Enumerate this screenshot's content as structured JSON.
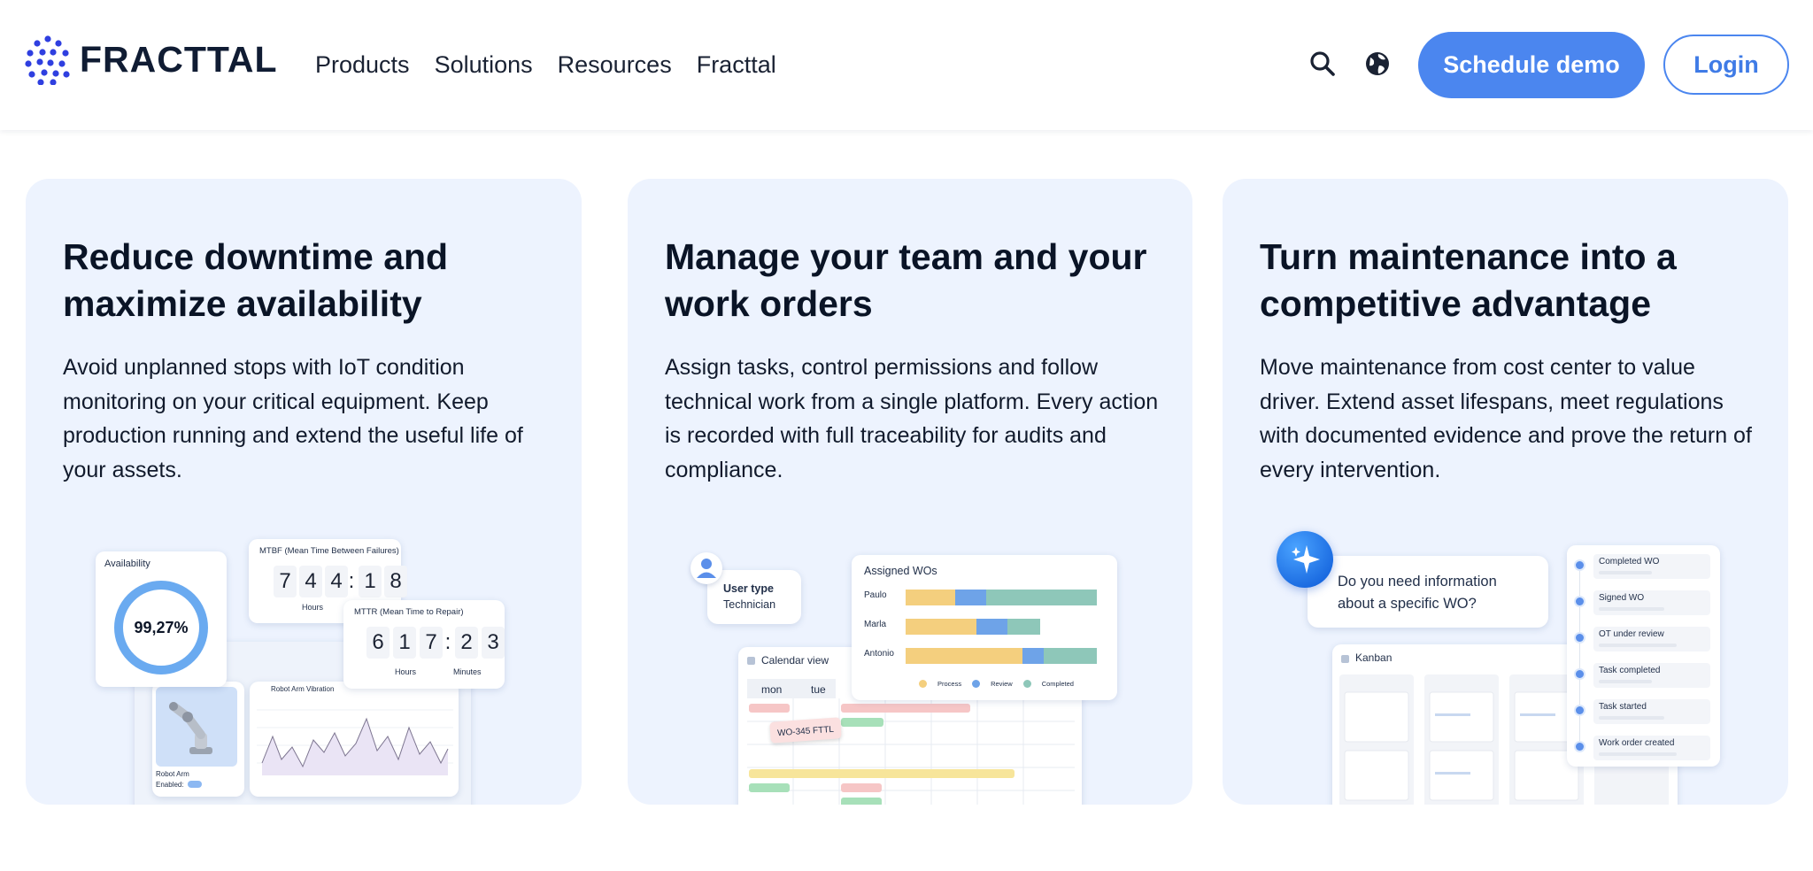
{
  "brand": {
    "name": "FRACTTAL",
    "accent": "#4b86ef",
    "logo_dot_color": "#2f3fe0"
  },
  "nav": {
    "items": [
      "Products",
      "Solutions",
      "Resources",
      "Fracttal"
    ]
  },
  "header": {
    "search_icon": "search-icon",
    "language_icon": "globe-icon",
    "demo_label": "Schedule demo",
    "login_label": "Login"
  },
  "cards": [
    {
      "title": "Reduce downtime and maximize availability",
      "body": "Avoid unplanned stops with IoT condition monitoring on your critical equipment. Keep production running and extend the useful life of your assets.",
      "widgets": {
        "availability_label": "Availability",
        "availability_value": "99,27%",
        "availability_fraction": 0.9927,
        "mtbf_label": "MTBF (Mean Time Between Failures)",
        "mtbf_digits": [
          "7",
          "4",
          "4",
          ":",
          "1",
          "8"
        ],
        "mtbf_unit": "Hours",
        "mttr_label": "MTTR (Mean Time to Repair)",
        "mttr_digits": [
          "6",
          "1",
          "7",
          ":",
          "2",
          "3"
        ],
        "mttr_unit_hours": "Hours",
        "mttr_unit_minutes": "Minutes",
        "vibration_label": "Robot Arm Vibration",
        "robot_label": "Robot Arm",
        "robot_enabled": "Enabled:"
      }
    },
    {
      "title": "Manage your team and your work orders",
      "body": "Assign tasks, control permissions and follow technical work from a single platform. Every action is recorded with full traceability for audits and compliance.",
      "widgets": {
        "user_type_label": "User type",
        "user_type_value": "Technician",
        "assigned_title": "Assigned WOs",
        "assigned_rows": [
          {
            "name": "Paulo",
            "process": 0.26,
            "review": 0.16,
            "completed": 0.58
          },
          {
            "name": "Marla",
            "process": 0.37,
            "review": 0.16,
            "completed": 0.17
          },
          {
            "name": "Antonio",
            "process": 0.61,
            "review": 0.11,
            "completed": 0.28
          }
        ],
        "legend": [
          "Process",
          "Review",
          "Completed"
        ],
        "calendar_title": "Calendar view",
        "days": [
          "mon",
          "tue"
        ],
        "wo_tag": "WO-345 FTTL"
      }
    },
    {
      "title": "Turn maintenance into a competitive advantage",
      "body": "Move maintenance from cost center to value driver. Extend asset lifespans, meet regulations with documented evidence and prove the return of every intervention.",
      "widgets": {
        "assistant_question": "Do you need information about a specific WO?",
        "kanban_title": "Kanban",
        "timeline": [
          "Completed WO",
          "Signed WO",
          "OT under review",
          "Task completed",
          "Task started",
          "Work order created"
        ]
      }
    }
  ],
  "colors": {
    "card_bg": "#edf3fe",
    "process": "#f4cf7e",
    "review": "#6ea3e8",
    "completed": "#8ec7b9",
    "ring": "#6aaaf0"
  }
}
